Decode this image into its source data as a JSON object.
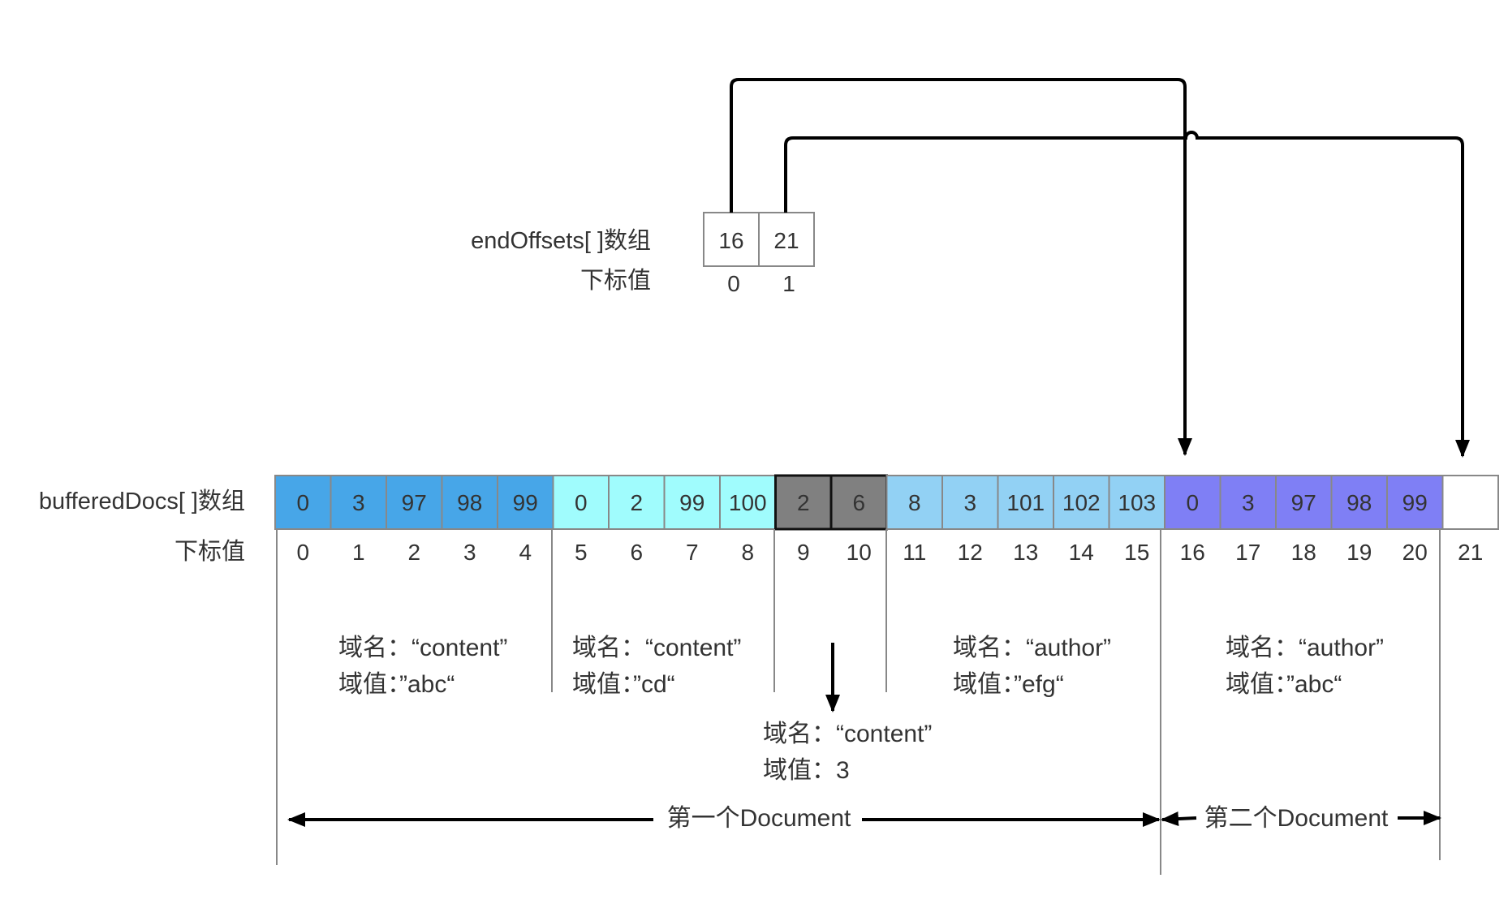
{
  "end_offsets": {
    "label": "endOffsets[ ]数组",
    "index_label": "下标值",
    "values": [
      "16",
      "21"
    ],
    "indices": [
      "0",
      "1"
    ]
  },
  "buffered_docs": {
    "label": "bufferedDocs[ ]数组",
    "index_label": "下标值",
    "values": [
      "0",
      "3",
      "97",
      "98",
      "99",
      "0",
      "2",
      "99",
      "100",
      "2",
      "6",
      "8",
      "3",
      "101",
      "102",
      "103",
      "0",
      "3",
      "97",
      "98",
      "99",
      ""
    ],
    "indices": [
      "0",
      "1",
      "2",
      "3",
      "4",
      "5",
      "6",
      "7",
      "8",
      "9",
      "10",
      "11",
      "12",
      "13",
      "14",
      "15",
      "16",
      "17",
      "18",
      "19",
      "20",
      "21"
    ],
    "groups": [
      {
        "start": 0,
        "end": 4,
        "color": "#47A6E8"
      },
      {
        "start": 5,
        "end": 8,
        "color": "#A0FCFD"
      },
      {
        "start": 9,
        "end": 10,
        "color": "#808080"
      },
      {
        "start": 11,
        "end": 15,
        "color": "#92D1F4"
      },
      {
        "start": 16,
        "end": 20,
        "color": "#7F7FF5"
      },
      {
        "start": 21,
        "end": 21,
        "color": "#FFFFFF"
      }
    ]
  },
  "annotations": [
    {
      "name": "域名：“content”",
      "value": "域值：”abc“"
    },
    {
      "name": "域名：“content”",
      "value": "域值：”cd“"
    },
    {
      "name": "域名：“content”",
      "value": "域值：3"
    },
    {
      "name": "域名：“author”",
      "value": "域值：”efg“"
    },
    {
      "name": "域名：“author”",
      "value": "域值：”abc“"
    }
  ],
  "documents": {
    "first": "第一个Document",
    "second": "第二个Document"
  }
}
